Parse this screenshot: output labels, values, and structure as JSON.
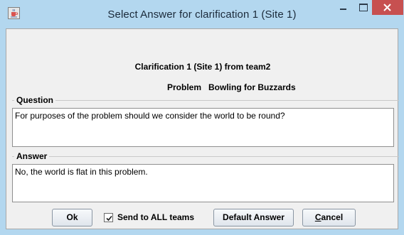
{
  "window": {
    "title": "Select Answer for clarification 1 (Site 1)",
    "app_icon": "java-cup-icon",
    "controls": [
      "minimize-icon",
      "maximize-icon",
      "close-icon"
    ],
    "accent_color": "#b3d7ef",
    "close_color": "#c75050"
  },
  "header": {
    "heading": "Clarification 1 (Site 1) from team2",
    "problem_label": "Problem",
    "problem_name": "Bowling for Buzzards"
  },
  "question": {
    "label": "Question",
    "text": "For purposes of the problem should we consider the world to be round?"
  },
  "answer": {
    "label": "Answer",
    "text": "No, the world is flat in this problem."
  },
  "buttons": {
    "ok": "Ok",
    "send_all_label": "Send to ALL teams",
    "send_all_checked": true,
    "default_answer": "Default Answer",
    "cancel_first": "C",
    "cancel_rest": "ancel"
  }
}
